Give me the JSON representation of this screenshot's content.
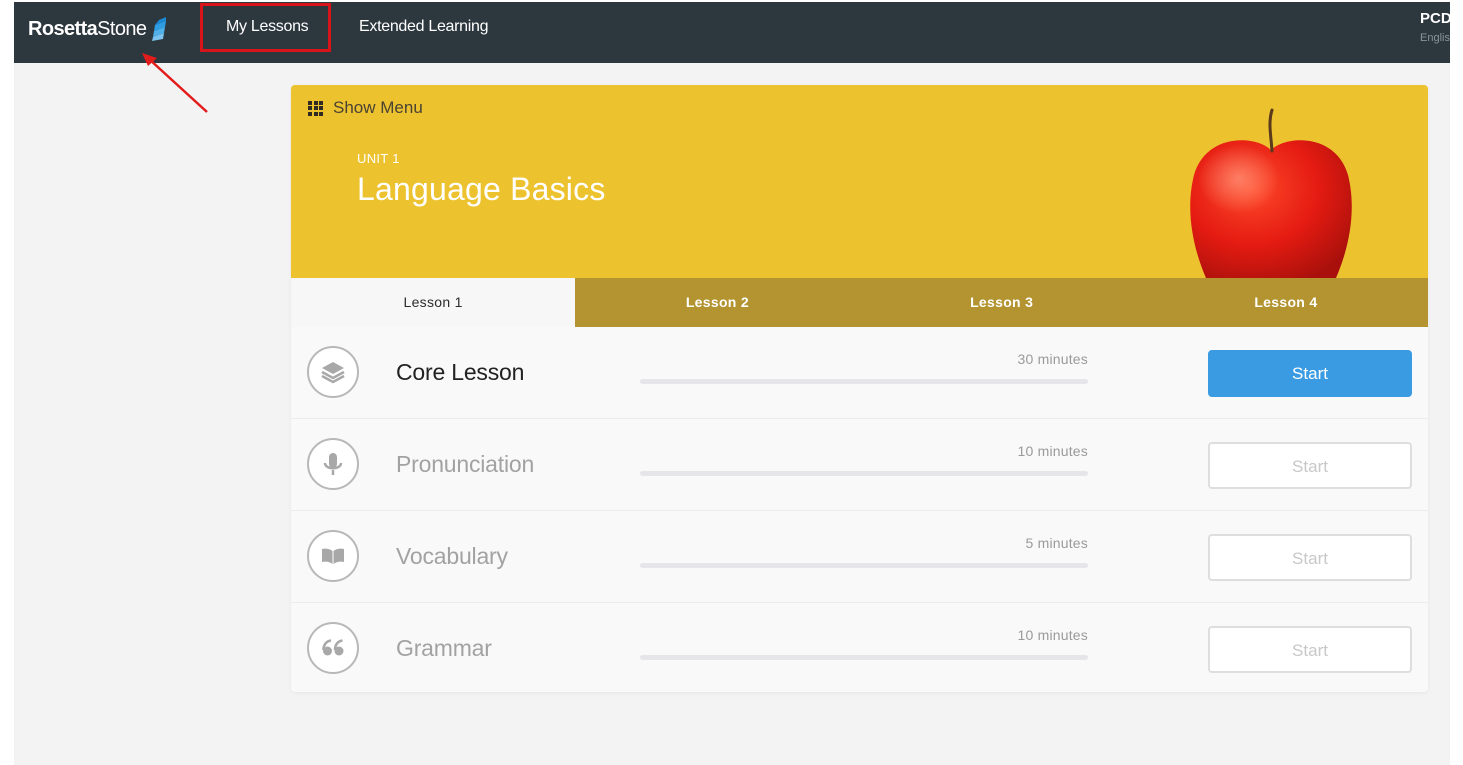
{
  "app": {
    "logo_bold": "Rosetta",
    "logo_light": "Stone"
  },
  "nav": {
    "my_lessons": "My Lessons",
    "extended_learning": "Extended Learning"
  },
  "user": {
    "name": "PCD",
    "language": "English"
  },
  "unit": {
    "show_menu": "Show Menu",
    "label": "UNIT 1",
    "title": "Language Basics",
    "hero_color": "#edc22f"
  },
  "tabs": [
    {
      "label": "Lesson 1",
      "active": true
    },
    {
      "label": "Lesson 2",
      "active": false
    },
    {
      "label": "Lesson 3",
      "active": false
    },
    {
      "label": "Lesson 4",
      "active": false
    }
  ],
  "lessons": [
    {
      "title": "Core Lesson",
      "duration": "30 minutes",
      "button": "Start",
      "icon": "layers-icon",
      "enabled": true,
      "progress": 0
    },
    {
      "title": "Pronunciation",
      "duration": "10 minutes",
      "button": "Start",
      "icon": "microphone-icon",
      "enabled": false,
      "progress": 0
    },
    {
      "title": "Vocabulary",
      "duration": "5 minutes",
      "button": "Start",
      "icon": "book-icon",
      "enabled": false,
      "progress": 0
    },
    {
      "title": "Grammar",
      "duration": "10 minutes",
      "button": "Start",
      "icon": "quote-icon",
      "enabled": false,
      "progress": 0
    }
  ],
  "colors": {
    "topbar": "#2d373e",
    "accent": "#3a9be2",
    "tab_bar": "#b39431",
    "annotation": "#d8141b"
  }
}
